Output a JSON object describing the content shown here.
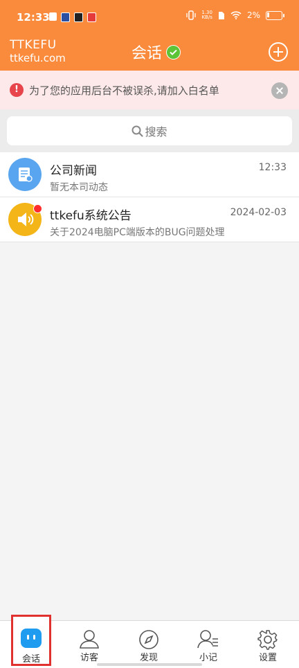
{
  "status_bar": {
    "time": "12:33",
    "net_speed": "1.30",
    "net_unit": "KB/s",
    "battery": "2%"
  },
  "header": {
    "brand_line1": "TTKEFU",
    "brand_line2": "ttkefu.com",
    "title": "会话"
  },
  "banner": {
    "text": "为了您的应用后台不被误杀,请加入白名单"
  },
  "search": {
    "label": "搜索"
  },
  "conversations": [
    {
      "name": "公司新闻",
      "subtitle": "暂无本司动态",
      "time": "12:33",
      "icon": "news-icon"
    },
    {
      "name": "ttkefu系统公告",
      "subtitle": "关于2024电脑PC端版本的BUG问题处理",
      "time": "2024-02-03",
      "icon": "speaker-icon"
    }
  ],
  "tabs": [
    {
      "label": "会话",
      "icon": "chat-icon"
    },
    {
      "label": "访客",
      "icon": "visitor-icon"
    },
    {
      "label": "发现",
      "icon": "compass-icon"
    },
    {
      "label": "小记",
      "icon": "notes-icon"
    },
    {
      "label": "设置",
      "icon": "gear-icon"
    }
  ],
  "colors": {
    "header": "#fb8b3c",
    "banner_bg": "#fde9e9",
    "active_tab": "#1f9bf0",
    "highlight_box": "#e0312f"
  }
}
